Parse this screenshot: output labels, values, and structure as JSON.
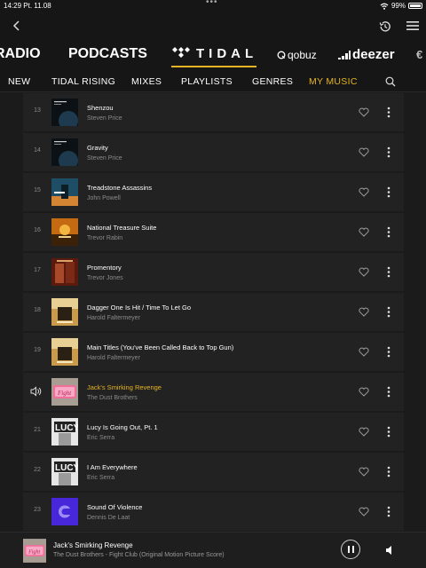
{
  "status": {
    "time": "14:29",
    "date": "Pt. 11.08",
    "battery": "99%",
    "battery_level": 0.99
  },
  "sources": {
    "radio": "RADIO",
    "podcasts": "PODCASTS",
    "tidal": "TIDAL",
    "qobuz": "qobuz",
    "deezer": "deezer",
    "more": "€"
  },
  "tabs": [
    "NEW",
    "TIDAL RISING",
    "MIXES",
    "PLAYLISTS",
    "GENRES",
    "MY MUSIC"
  ],
  "active_tab": "MY MUSIC",
  "accent_color": "#e6b422",
  "tracks": [
    {
      "num": "13",
      "title": "Shenzou",
      "artist": "Steven Price",
      "art": "gravity"
    },
    {
      "num": "14",
      "title": "Gravity",
      "artist": "Steven Price",
      "art": "gravity"
    },
    {
      "num": "15",
      "title": "Treadstone Assassins",
      "artist": "John Powell",
      "art": "bourne"
    },
    {
      "num": "16",
      "title": "National Treasure Suite",
      "artist": "Trevor Rabin",
      "art": "treasure"
    },
    {
      "num": "17",
      "title": "Promentory",
      "artist": "Trevor Jones",
      "art": "mohicans"
    },
    {
      "num": "18",
      "title": "Dagger One Is Hit / Time To Let Go",
      "artist": "Harold Faltermeyer",
      "art": "topgun"
    },
    {
      "num": "19",
      "title": "Main Titles (You've Been Called Back to Top Gun)",
      "artist": "Harold Faltermeyer",
      "art": "topgun"
    },
    {
      "num": "",
      "title": "Jack's Smirking Revenge",
      "artist": "The Dust Brothers",
      "art": "fightclub",
      "playing": true
    },
    {
      "num": "21",
      "title": "Lucy Is Going Out, Pt. 1",
      "artist": "Eric Serra",
      "art": "lucy"
    },
    {
      "num": "22",
      "title": "I Am Everywhere",
      "artist": "Eric Serra",
      "art": "lucy"
    },
    {
      "num": "23",
      "title": "Sound Of Violence",
      "artist": "Dennis De Laat",
      "art": "violence"
    }
  ],
  "player": {
    "title": "Jack's Smirking Revenge",
    "subtitle": "The Dust Brothers - Fight Club (Original Motion Picture Score)"
  },
  "icons": {
    "back": "chevron-left-icon",
    "history": "history-icon",
    "menu": "hamburger-menu-icon",
    "search": "search-icon",
    "heart": "heart-outline-icon",
    "more": "kebab-icon",
    "playing": "speaker-icon",
    "pause": "pause-icon",
    "volume": "volume-icon"
  }
}
